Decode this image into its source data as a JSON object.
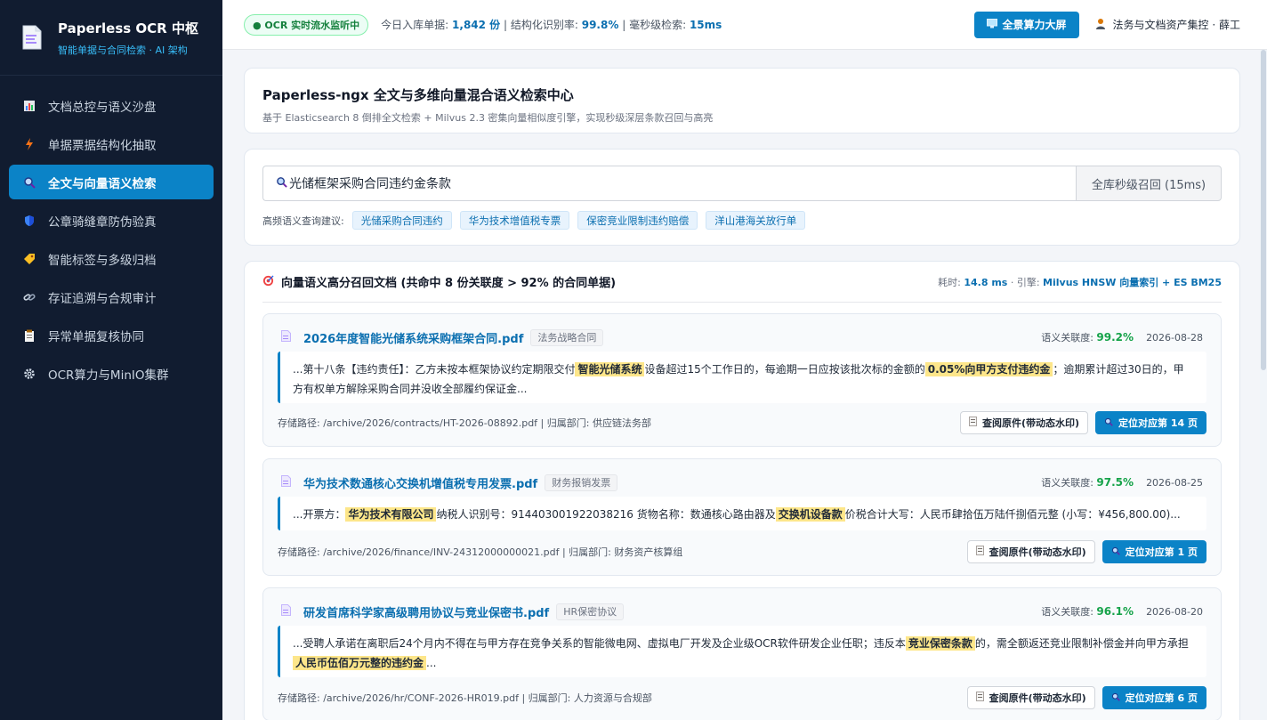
{
  "brand": {
    "title": "Paperless OCR 中枢",
    "subtitle": "智能单据与合同检索 · AI 架构"
  },
  "nav": [
    {
      "label": "文档总控与语义沙盘",
      "icon": "bar-chart-icon"
    },
    {
      "label": "单据票据结构化抽取",
      "icon": "lightning-icon"
    },
    {
      "label": "全文与向量语义检索",
      "icon": "magnifier-icon",
      "active": true
    },
    {
      "label": "公章骑缝章防伪验真",
      "icon": "shield-icon"
    },
    {
      "label": "智能标签与多级归档",
      "icon": "tag-icon"
    },
    {
      "label": "存证追溯与合规审计",
      "icon": "link-icon"
    },
    {
      "label": "异常单据复核协同",
      "icon": "clipboard-icon"
    },
    {
      "label": "OCR算力与MinIO集群",
      "icon": "gear-icon"
    }
  ],
  "topbar": {
    "live_badge": "● OCR 实时流水监听中",
    "stat1_label": "今日入库单据:",
    "stat1_value": "1,842 份",
    "stat2_label": "结构化识别率:",
    "stat2_value": "99.8%",
    "stat3_label": "毫秒级检索:",
    "stat3_value": "15ms",
    "screen_button": "全景算力大屏",
    "user": "法务与文档资产集控 · 薛工"
  },
  "header": {
    "title": "Paperless-ngx 全文与多维向量混合语义检索中心",
    "subtitle": "基于 Elasticsearch 8 倒排全文检索 + Milvus 2.3 密集向量相似度引擎，实现秒级深层条款召回与高亮"
  },
  "search": {
    "value": "光储框架采购合同违约金条款",
    "button": "全库秒级召回 (15ms)",
    "suggest_label": "高频语义查询建议:",
    "suggestions": [
      "光储采购合同违约",
      "华为技术增值税专票",
      "保密竞业限制违约赔偿",
      "洋山港海关放行单"
    ]
  },
  "results": {
    "title": "向量语义高分召回文档 (共命中 8 份关联度 > 92% 的合同单据)",
    "meta_time_label": "耗时:",
    "meta_time": "14.8 ms",
    "meta_engine_label": "· 引擎:",
    "meta_engine": "Milvus HNSW 向量索引 + ES BM25",
    "score_label": "语义关联度:",
    "view_button": "查阅原件(带动态水印)",
    "docs": [
      {
        "title": "2026年度智能光储系统采购框架合同.pdf",
        "tag": "法务战略合同",
        "score": "99.2%",
        "date": "2026-08-28",
        "s1": "...第十八条【违约责任】：乙方未按本框架协议约定期限交付",
        "h1": "智能光储系统",
        "s2": "设备超过15个工作日的，每逾期一日应按该批次标的金额的",
        "h2": "0.05%向甲方支付违约金",
        "s3": "；逾期累计超过30日的，甲方有权单方解除采购合同并没收全部履约保证金...",
        "path": "存储路径: /archive/2026/contracts/HT-2026-08892.pdf | 归属部门: 供应链法务部",
        "locate": "定位对应第 14 页"
      },
      {
        "title": "华为技术数通核心交换机增值税专用发票.pdf",
        "tag": "财务报销发票",
        "score": "97.5%",
        "date": "2026-08-25",
        "s1": "...开票方：",
        "h1": "华为技术有限公司",
        "s2": "纳税人识别号：914403001922038216 货物名称：数通核心路由器及",
        "h2": "交换机设备款",
        "s3": "价税合计大写：人民币肆拾伍万陆仟捌佰元整 (小写：¥456,800.00)...",
        "path": "存储路径: /archive/2026/finance/INV-24312000000021.pdf | 归属部门: 财务资产核算组",
        "locate": "定位对应第 1 页"
      },
      {
        "title": "研发首席科学家高级聘用协议与竞业保密书.pdf",
        "tag": "HR保密协议",
        "score": "96.1%",
        "date": "2026-08-20",
        "s1": "...受聘人承诺在离职后24个月内不得在与甲方存在竞争关系的智能微电网、虚拟电厂开发及企业级OCR软件研发企业任职；违反本",
        "h1": "竞业保密条款",
        "s2": "的，需全额返还竞业限制补偿金并向甲方承担",
        "h2": "人民币伍佰万元整的违约金",
        "s3": "...",
        "path": "存储路径: /archive/2026/hr/CONF-2026-HR019.pdf | 归属部门: 人力资源与合规部",
        "locate": "定位对应第 6 页"
      }
    ]
  },
  "colors": {
    "sidebar": "#111c30",
    "accent": "#0b83c7",
    "highlight": "#fde68a",
    "score": "#16a34a"
  }
}
